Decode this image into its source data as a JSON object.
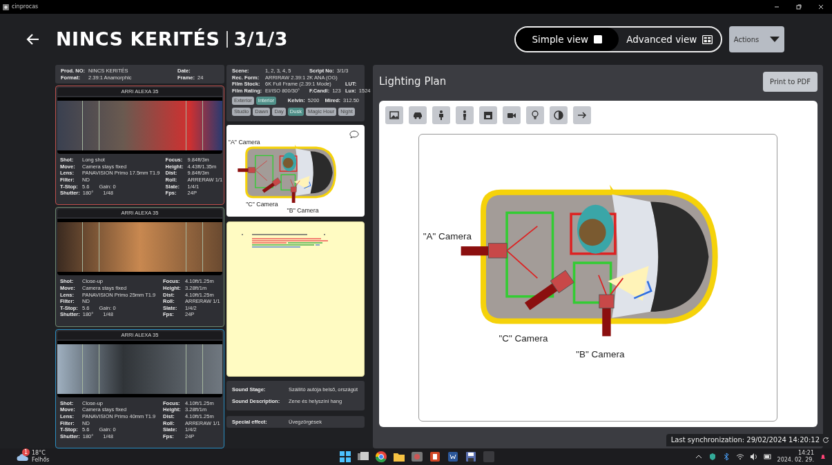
{
  "window": {
    "title": "cinprocas"
  },
  "header": {
    "title": "NINCS KERITÉS",
    "number": "3/1/3"
  },
  "view_toggle": [
    {
      "label": "Simple view",
      "selected": true,
      "kind": "single"
    },
    {
      "label": "Advanced view",
      "selected": false,
      "kind": "grid"
    }
  ],
  "actions_button": "Actions",
  "production": [
    [
      {
        "label": "Prod. NO:",
        "value": "NINCS KERITÉS"
      },
      {
        "label": "Date:"
      }
    ],
    [
      {
        "label": "Format:",
        "value": "2.39:1 Anamorphic"
      },
      {
        "label": "Frame:",
        "value": "24"
      }
    ]
  ],
  "shots": [
    {
      "camera": "ARRI ALEXA 35",
      "color": "#c0504d",
      "left": [
        {
          "label": "Shot:",
          "value": "Long shot"
        },
        {
          "label": "Move:",
          "value": "Camera stays fixed"
        },
        {
          "label": "Lens:",
          "value": "PANAVISION Primo 17.5mm T1.9"
        },
        {
          "label": "Filter:",
          "value": "ND"
        },
        {
          "label": "T-Stop:",
          "value": "5.6",
          "extra": "Gain: 0"
        },
        {
          "label": "Shutter:",
          "value": "180°",
          "extra": "1/48"
        }
      ],
      "right": [
        {
          "label": "Focus:",
          "value": "9.84ft/3m"
        },
        {
          "label": "Height:",
          "value": "4.43ft/1.35m"
        },
        {
          "label": "Dist:",
          "value": "9.84ft/3m"
        },
        {
          "label": "Roll:",
          "value": "ARRERAW 1/1"
        },
        {
          "label": "Slate:",
          "value": "1/4/1"
        },
        {
          "label": "Fps:",
          "value": "24P"
        }
      ]
    },
    {
      "camera": "ARRI ALEXA 35",
      "color": "#6f8a70",
      "left": [
        {
          "label": "Shot:",
          "value": "Close-up"
        },
        {
          "label": "Move:",
          "value": "Camera stays fixed"
        },
        {
          "label": "Lens:",
          "value": "PANAVISION Primo 25mm T1.9"
        },
        {
          "label": "Filter:",
          "value": "ND"
        },
        {
          "label": "T-Stop:",
          "value": "5.6",
          "extra": "Gain: 0"
        },
        {
          "label": "Shutter:",
          "value": "180°",
          "extra": "1/48"
        }
      ],
      "right": [
        {
          "label": "Focus:",
          "value": "4.10ft/1.25m"
        },
        {
          "label": "Height:",
          "value": "3.28ft/1m"
        },
        {
          "label": "Dist:",
          "value": "4.10ft/1.25m"
        },
        {
          "label": "Roll:",
          "value": "ARRERAW 1/1"
        },
        {
          "label": "Slate:",
          "value": "1/4/2"
        },
        {
          "label": "Fps:",
          "value": "24P"
        }
      ]
    },
    {
      "camera": "ARRI ALEXA 35",
      "color": "#2a8fc4",
      "left": [
        {
          "label": "Shot:",
          "value": "Close-up"
        },
        {
          "label": "Move:",
          "value": "Camera stays fixed"
        },
        {
          "label": "Lens:",
          "value": "PANAVISION Primo 40mm T1.9"
        },
        {
          "label": "Filter:",
          "value": "ND"
        },
        {
          "label": "T-Stop:",
          "value": "5.6",
          "extra": "Gain: 0"
        },
        {
          "label": "Shutter:",
          "value": "180°",
          "extra": "1/48"
        }
      ],
      "right": [
        {
          "label": "Focus:",
          "value": "4.10ft/1.25m"
        },
        {
          "label": "Height:",
          "value": "3.28ft/1m"
        },
        {
          "label": "Dist:",
          "value": "4.10ft/1.25m"
        },
        {
          "label": "Roll:",
          "value": "ARRERAW 1/1"
        },
        {
          "label": "Slate:",
          "value": "1/4/2"
        },
        {
          "label": "Fps:",
          "value": "24P"
        }
      ]
    }
  ],
  "scene": {
    "rows": [
      [
        {
          "label": "Scene:",
          "value": "1, 2, 3, 4, 5"
        },
        {
          "label": "Script No:",
          "value": "3/1/3"
        }
      ],
      [
        {
          "label": "Rec. Form:",
          "value": "ARRIRAW 2.39:1 2K ANA (OG)"
        }
      ],
      [
        {
          "label": "Film Stock:",
          "value": "6K Full Frame (2.39:1 Mode)"
        },
        "",
        {
          "label": "LUT:"
        }
      ],
      [
        {
          "label": "Film Rating:",
          "value": "EI/ISO 800/30°"
        },
        {
          "label": "F.Candl:",
          "value": "123"
        },
        {
          "label": "Lux:",
          "value": "1524"
        }
      ]
    ],
    "location_tags": [
      {
        "label": "Exterior",
        "selected": false
      },
      {
        "label": "Interior",
        "selected": true
      }
    ],
    "light_values": [
      {
        "label": "Kelvin:",
        "value": "5200"
      },
      {
        "label": "Mired:",
        "value": "312.50"
      }
    ],
    "time_tags": [
      {
        "label": "Studio",
        "selected": false
      },
      {
        "label": "Dawn",
        "selected": false
      },
      {
        "label": "Day",
        "selected": false
      },
      {
        "label": "Dusk",
        "selected": true
      },
      {
        "label": "Magic Hour",
        "selected": false
      },
      {
        "label": "Night",
        "selected": false
      }
    ]
  },
  "thumbnail": {
    "camera_labels": [
      "\"A\" Camera",
      "\"C\" Camera",
      "\"B\" Camera"
    ]
  },
  "sound": [
    {
      "label": "Sound Stage:",
      "value": "Szállító autója belső, országút"
    },
    {
      "label": "Sound Description:",
      "value": "Zene és helyszíni hang"
    }
  ],
  "special_effect": {
    "label": "Special effect:",
    "value": "Üvegzörgések"
  },
  "lighting_plan": {
    "title": "Lighting Plan",
    "print_button": "Print to PDF",
    "camera_labels": [
      "\"A\" Camera",
      "\"C\" Camera",
      "\"B\" Camera"
    ]
  },
  "sync_status": "Last synchronization: 29/02/2024 14:20:12",
  "taskbar": {
    "weather": {
      "badge": "1",
      "temperature": "18°C",
      "condition": "Felhős"
    },
    "clock": {
      "time": "14:21",
      "date": "2024. 02. 29."
    }
  }
}
